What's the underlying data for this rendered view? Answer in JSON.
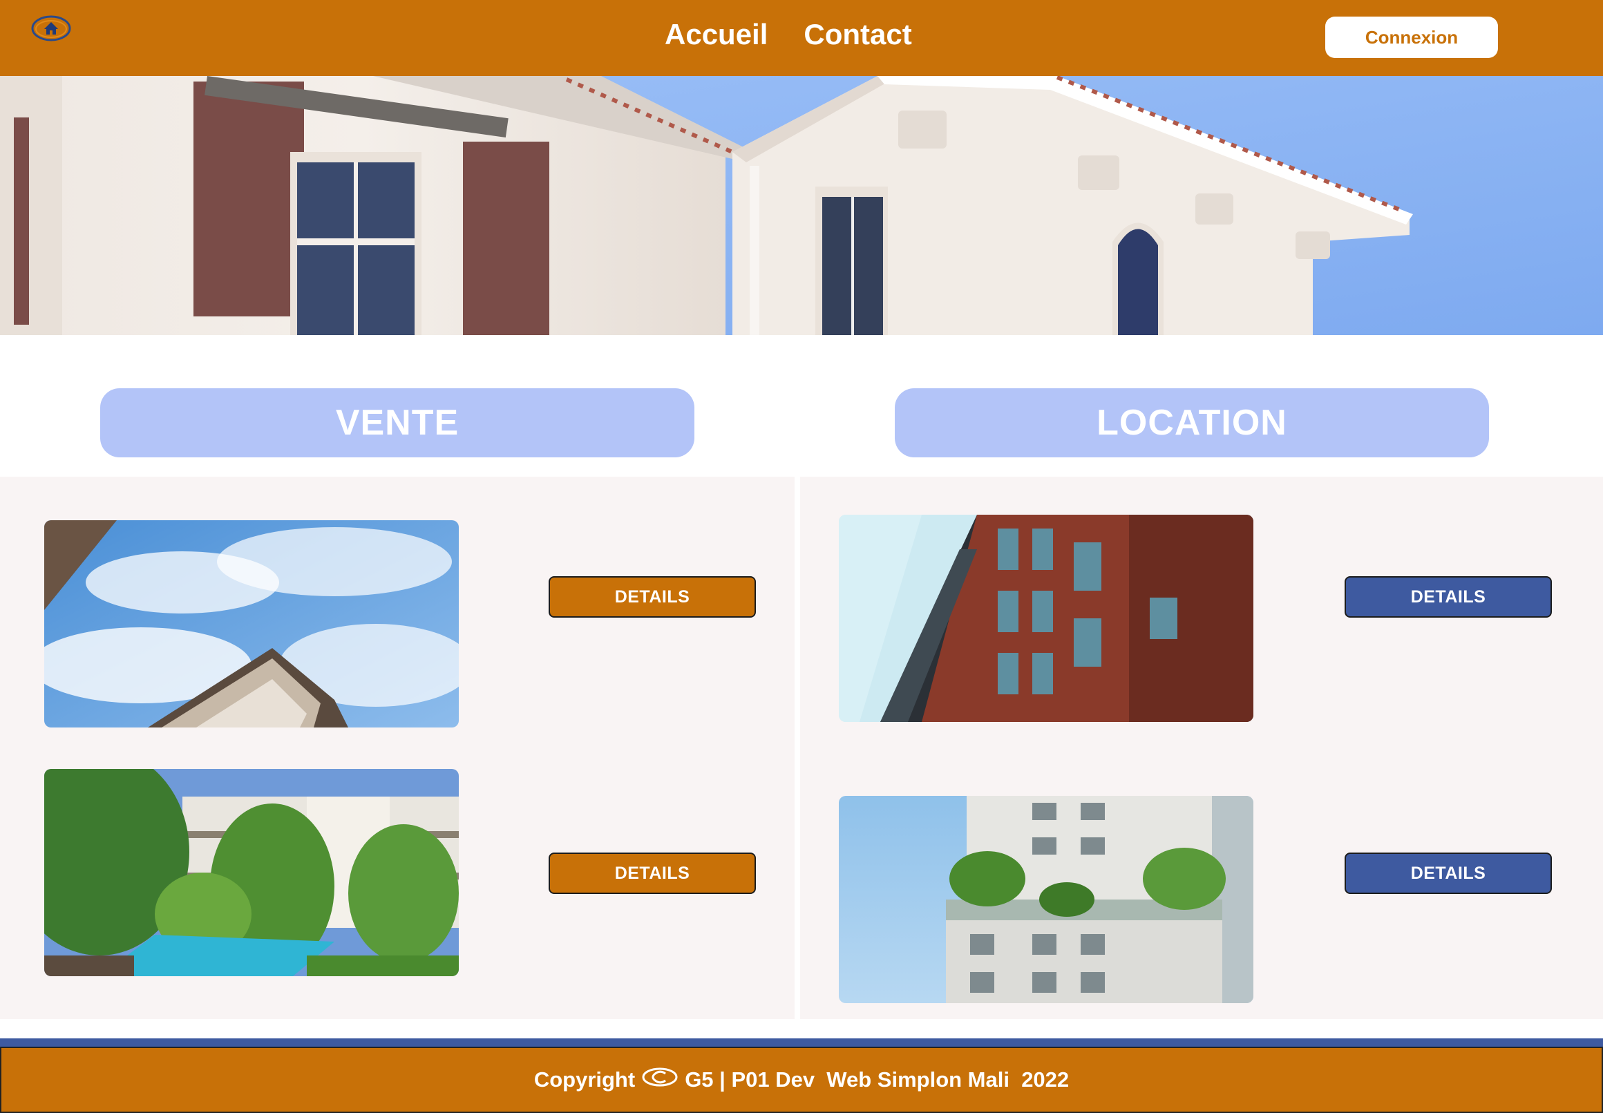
{
  "nav": {
    "links": [
      "Accueil",
      "Contact"
    ],
    "login_label": "Connexion"
  },
  "sections": {
    "sale_title": "VENTE",
    "rent_title": "LOCATION"
  },
  "listings": {
    "sale": [
      {
        "image": "apartment-building-sky-photo",
        "button": "DETAILS"
      },
      {
        "image": "residence-pool-garden-photo",
        "button": "DETAILS"
      }
    ],
    "rent": [
      {
        "image": "brick-apartment-tower-photo",
        "button": "DETAILS"
      },
      {
        "image": "white-apartment-balconies-photo",
        "button": "DETAILS"
      }
    ]
  },
  "footer": {
    "text_before": "Copyright",
    "text_after": "G5 | P01 Dev  Web Simplon Mali  2022"
  },
  "colors": {
    "primary": "#c87108",
    "secondary": "#3e5aa0",
    "pill": "#b3c4f8",
    "panel": "#f9f4f4"
  }
}
